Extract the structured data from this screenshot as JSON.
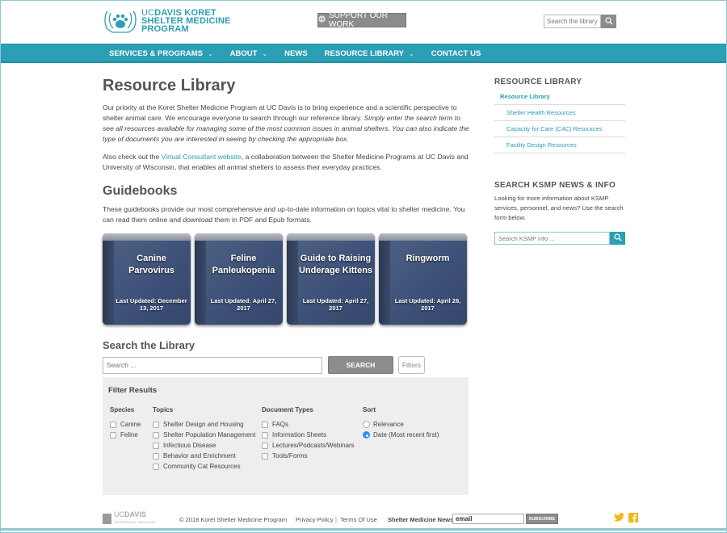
{
  "header": {
    "logo": {
      "line1_uc": "UC",
      "line1_rest": "DAVIS KORET",
      "line2": "SHELTER MEDICINE",
      "line3": "PROGRAM"
    },
    "support_label": "SUPPORT OUR WORK",
    "search_placeholder": "Search the library ..."
  },
  "nav": {
    "items": [
      {
        "label": "SERVICES & PROGRAMS",
        "has_dropdown": true
      },
      {
        "label": "ABOUT",
        "has_dropdown": true
      },
      {
        "label": "NEWS",
        "has_dropdown": false
      },
      {
        "label": "RESOURCE LIBRARY",
        "has_dropdown": true
      },
      {
        "label": "CONTACT US",
        "has_dropdown": false
      }
    ],
    "chevron": "⌄"
  },
  "main": {
    "title": "Resource Library",
    "intro_plain": "Our priority at the Koret Shelter Medicine Program at UC Davis is to bring experience and a scientific perspective to shelter animal care.  We encourage everyone to search through our reference library.  ",
    "intro_italic": "Simply enter the search term to see all resources available for managing some of the most common issues in animal shelters.  You can also indicate the type of documents you are interested in seeing by checking the appropriate box.",
    "also_before": "Also check out the ",
    "also_link": "Virtual Consultant website",
    "also_after": ", a collaboration between the Shelter Medicine Programs at UC Davis and University of Wisconsin, that enables all animal shelters to assess their everyday practices.",
    "guidebooks_title": "Guidebooks",
    "guidebooks_desc": "These guidebooks provide our most comprehensive and up-to-date information on topics vital to shelter medicine. You can read them online and download them in PDF and Epub formats.",
    "books": [
      {
        "title": "Canine Parvovirus",
        "updated": "Last Updated: December 13, 2017"
      },
      {
        "title": "Feline Panleukopenia",
        "updated": "Last Updated: April 27, 2017"
      },
      {
        "title": "Guide to Raising Underage Kittens",
        "updated": "Last Updated: April 27, 2017"
      },
      {
        "title": "Ringworm",
        "updated": "Last Updated: April 28, 2017"
      }
    ],
    "search_title": "Search the Library",
    "search_placeholder": "Search ...",
    "search_button": "SEARCH",
    "filters_button": "Filters",
    "filter": {
      "title": "Filter Results",
      "species": {
        "label": "Species",
        "options": [
          "Canine",
          "Feline"
        ]
      },
      "topics": {
        "label": "Topics",
        "options": [
          "Shelter Design and Housing",
          "Shelter Population Management",
          "Infectious Disease",
          "Behavior and Enrichment",
          "Community Cat Resources"
        ]
      },
      "doc_types": {
        "label": "Document Types",
        "options": [
          "FAQs",
          "Information Sheets",
          "Lectures/Podcasts/Webinars",
          "Tools/Forms"
        ]
      },
      "sort": {
        "label": "Sort",
        "options": [
          "Relevance",
          "Date (Most recent first)"
        ],
        "selected": "Date (Most recent first)"
      }
    }
  },
  "sidebar": {
    "heading": "RESOURCE LIBRARY",
    "items": [
      {
        "label": "Resource Library",
        "level": "main"
      },
      {
        "label": "Shelter Health Resources",
        "level": "sub"
      },
      {
        "label": "Capacity for Care (C4C) Resources",
        "level": "sub"
      },
      {
        "label": "Facility Design Resources",
        "level": "sub"
      }
    ],
    "search_heading": "SEARCH KSMP NEWS & INFO",
    "search_desc": "Looking for more information about KSMP services, personnel, and news? Use the search form below.",
    "search_placeholder": "Search KSMP info ..."
  },
  "footer": {
    "vet_logo_uc": "UC",
    "vet_logo_davis": "DAVIS",
    "vet_logo_sub": "VETERINARY MEDICINE",
    "copyright": "© 2018 Koret Shelter Medicine Program",
    "privacy": "Privacy Policy",
    "separator": "|",
    "terms": "Terms Of Use",
    "news_label": "Shelter Medicine News",
    "email_value": "email",
    "subscribe": "SUBSCRIBE",
    "social": {
      "twitter": "twitter-icon",
      "facebook": "facebook-icon"
    },
    "social_color": "#f5b712"
  },
  "colors": {
    "accent": "#2a9fb5",
    "button_gray": "#8c8c8c",
    "book_blue": "#3d5077",
    "radio_selected": "#2f8ef0"
  }
}
